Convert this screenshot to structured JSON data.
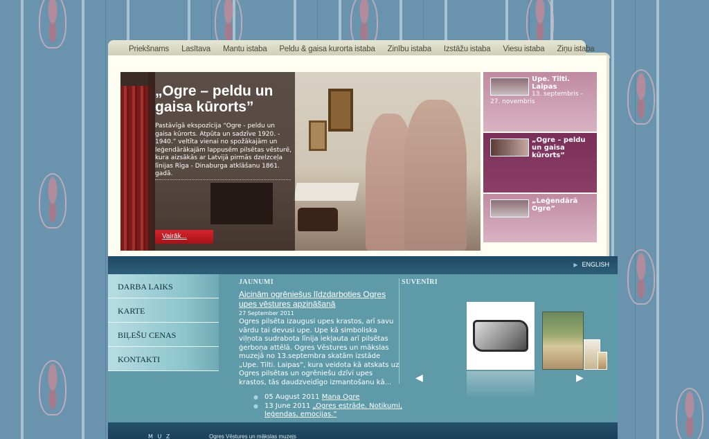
{
  "nav_tabs": [
    "Priekšnams",
    "Lasītava",
    "Mantu istaba",
    "Peldu & gaisa kurorta istaba",
    "Zinību istaba",
    "Izstāžu istaba",
    "Viesu istaba",
    "Ziņu istaba"
  ],
  "hero": {
    "title": "„Ogre – peldu un gaisa kūrorts”",
    "description": "Pastāvīgā ekspozīcija “Ogre - peldu un gaisa kūrorts. Atpūta un sadzīve 1920. - 1940.” veltīta vienai no spožākajām un leģendārākajām lappusēm pilsētas vēsturē, kura aizsākās ar Latvijā pirmās dzelzceļa līnijas Rīga - Dinaburga atklāšanu 1861. gadā.",
    "button": "Vairāk..."
  },
  "side_items": [
    {
      "title": "Upe. Tilti. Laipas",
      "date": "13. septembris - 27. novembris"
    },
    {
      "title": "„Ogre – peldu un gaisa kūrorts”",
      "date": ""
    },
    {
      "title": "„Leģendārā Ogre”",
      "date": ""
    }
  ],
  "lang": "ENGLISH",
  "left_nav": [
    "DARBA LAIKS",
    "KARTE",
    "BIĻEŠU CENAS",
    "KONTAKTI"
  ],
  "news": {
    "heading": "JAUNUMI",
    "title": "Aicinām ogrēniešus līdzdarboties Ogres upes vēstures apzināšanā",
    "date": "27 September 2011",
    "body": "Ogres pilsēta izaugusi upes krastos, arī savu vārdu tai devusi upe. Upe kā simboliska viļņota sudrabota līnija iekļauta arī pilsētas ģerboņa attēlā. Ogres Vēstures un mākslas muzejā no 13.septembra skatām izstāde „Upe. Tilti. Laipas”, kura veidota kā atskats uz Ogres pilsētas un ogrēniešu dzīvi upes krastos, tās daudzveidīgo izmantošanu kā...",
    "list": [
      {
        "date": "05 August 2011",
        "link": "Mana Ogre"
      },
      {
        "date": "13 June 2011",
        "link": "„Ogres estrāde. Notikumi, leģendas, emocijas.”"
      }
    ]
  },
  "souvenirs": {
    "heading": "SUVENĪRI"
  },
  "footer": {
    "logo": "M U Z",
    "text": "Ogres Vēstures un mākslas muzejs"
  },
  "colors": {
    "accent_red": "#c41a22",
    "active_item": "#7a2f59",
    "content_teal": "#5f9aa8",
    "band_blue": "#1f4a63"
  }
}
